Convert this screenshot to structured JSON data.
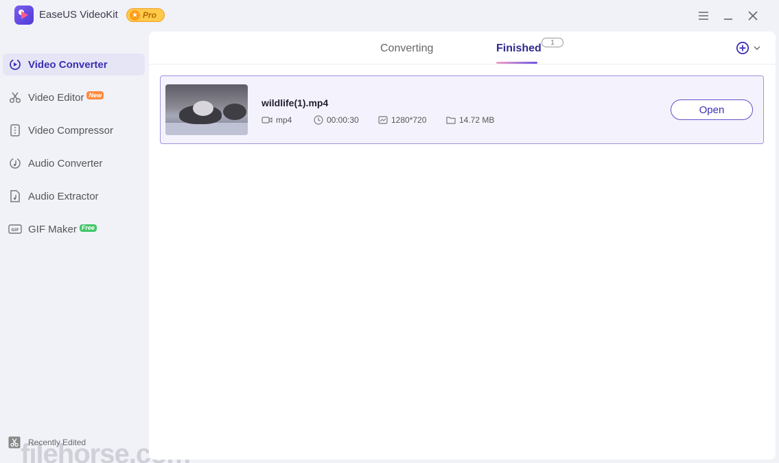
{
  "app": {
    "title": "EaseUS VideoKit",
    "badge": "Pro"
  },
  "sidebar": {
    "items": [
      {
        "label": "Video Converter",
        "active": true,
        "icon": "convert-icon"
      },
      {
        "label": "Video Editor",
        "tag": "New",
        "icon": "scissors-icon"
      },
      {
        "label": "Video Compressor",
        "icon": "compress-icon"
      },
      {
        "label": "Audio Converter",
        "icon": "audio-convert-icon"
      },
      {
        "label": "Audio Extractor",
        "icon": "audio-file-icon"
      },
      {
        "label": "GIF Maker",
        "tag": "Free",
        "icon": "gif-icon"
      }
    ],
    "recent_label": "Recently Edited",
    "watermark": "filehorse.com"
  },
  "tabs": {
    "converting": "Converting",
    "finished": "Finished",
    "finished_count": "1",
    "active": "finished"
  },
  "files": [
    {
      "name": "wildlife(1).mp4",
      "format": "mp4",
      "duration": "00:00:30",
      "resolution": "1280*720",
      "size": "14.72 MB",
      "action": "Open"
    }
  ],
  "colors": {
    "accent": "#3a2fb3",
    "card_border": "#9a92e0",
    "card_bg": "#f4f3fd",
    "pro_badge": "#ffc94a",
    "new_tag": "#ff8a3c",
    "free_tag": "#41c768"
  }
}
